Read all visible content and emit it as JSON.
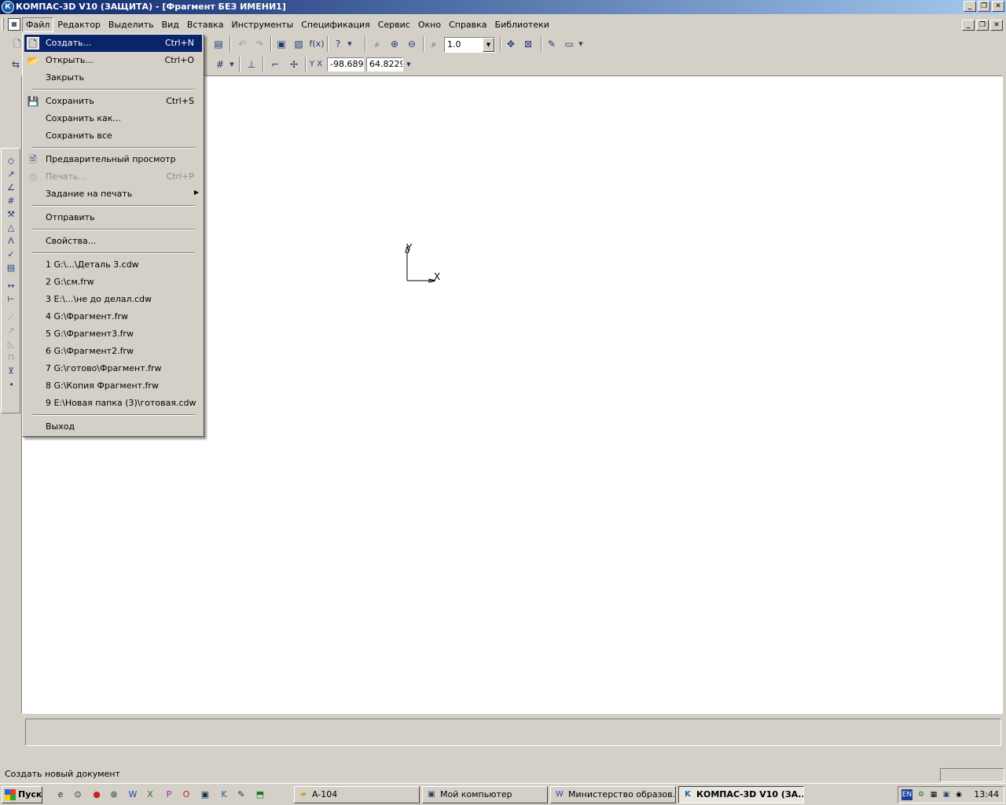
{
  "window": {
    "title": "КОМПАС-3D V10 (ЗАЩИТА) - [Фрагмент БЕЗ ИМЕНИ1]",
    "controls": [
      "_",
      "❐",
      "✕"
    ]
  },
  "menubar": {
    "items": [
      "Файл",
      "Редактор",
      "Выделить",
      "Вид",
      "Вставка",
      "Инструменты",
      "Спецификация",
      "Сервис",
      "Окно",
      "Справка",
      "Библиотеки"
    ]
  },
  "toolbar": {
    "zoom_value": "1.0",
    "coord_x": "-98.689",
    "coord_y": "64.8229"
  },
  "file_menu": {
    "items": [
      {
        "label": "Создать...",
        "shortcut": "Ctrl+N",
        "icon": "new-document-icon",
        "highlighted": true
      },
      {
        "label": "Открыть...",
        "shortcut": "Ctrl+O",
        "icon": "open-folder-icon"
      },
      {
        "label": "Закрыть",
        "shortcut": ""
      },
      {
        "label": "Сохранить",
        "shortcut": "Ctrl+S",
        "icon": "floppy-disk-icon"
      },
      {
        "label": "Сохранить как...",
        "shortcut": ""
      },
      {
        "label": "Сохранить все",
        "shortcut": ""
      },
      {
        "label": "Предварительный просмотр",
        "shortcut": "",
        "icon": "print-preview-icon"
      },
      {
        "label": "Печать...",
        "shortcut": "Ctrl+P",
        "icon": "printer-icon",
        "disabled": true
      },
      {
        "label": "Задание на печать",
        "shortcut": "",
        "submenu": true
      },
      {
        "label": "Отправить",
        "shortcut": ""
      },
      {
        "label": "Свойства...",
        "shortcut": ""
      },
      {
        "label": "1 G:\\...\\Деталь 3.cdw"
      },
      {
        "label": "2 G:\\см.frw"
      },
      {
        "label": "3 E:\\...\\не до делал.cdw"
      },
      {
        "label": "4 G:\\Фрагмент.frw"
      },
      {
        "label": "5 G:\\Фрагмент3.frw"
      },
      {
        "label": "6 G:\\Фрагмент2.frw"
      },
      {
        "label": "7 G:\\готово\\Фрагмент.frw"
      },
      {
        "label": "8 G:\\Копия Фрагмент.frw"
      },
      {
        "label": "9 E:\\Новая папка (3)\\готовая.cdw"
      },
      {
        "label": "Выход"
      }
    ]
  },
  "canvas": {
    "axis_y_label": "Y",
    "axis_x_label": "X"
  },
  "statusbar": {
    "text": "Создать новый документ"
  },
  "taskbar": {
    "start_label": "Пуск",
    "tasks": [
      {
        "label": "A-104",
        "icon": "folder-icon"
      },
      {
        "label": "Мой компьютер",
        "icon": "computer-icon"
      },
      {
        "label": "Министерство образов...",
        "icon": "word-doc-icon"
      },
      {
        "label": "КОМПАС-3D V10 (ЗА...",
        "icon": "kompas-icon",
        "active": true
      }
    ],
    "tray_lang": "EN",
    "clock": "13:44"
  },
  "colors": {
    "titlebar_start": "#0a246a",
    "titlebar_end": "#a6caf0",
    "highlight": "#0a246a",
    "face": "#d4d0c8"
  }
}
